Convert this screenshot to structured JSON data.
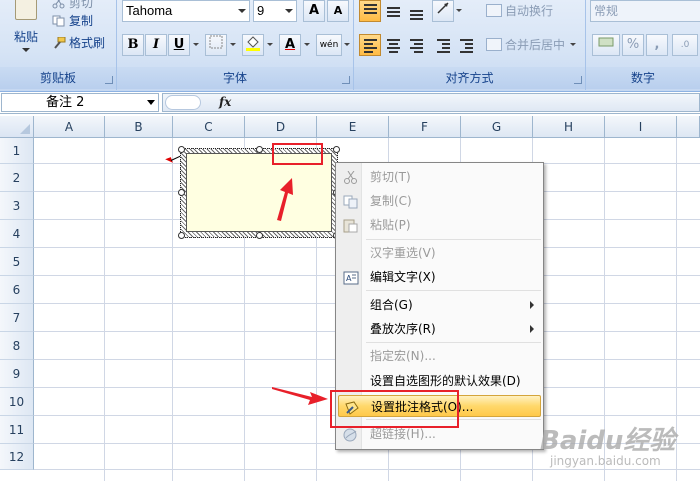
{
  "colors": {
    "accent_red": "#e8202a",
    "comment_fill": "#ffffe1",
    "menu_hover": "#ffd86b"
  },
  "ribbon": {
    "clipboard": {
      "label": "剪贴板",
      "paste": "粘贴",
      "cut": "剪切",
      "copy": "复制",
      "format_painter": "格式刷"
    },
    "font": {
      "label": "字体",
      "font_name": "Tahoma",
      "font_size": "9",
      "bold": "B",
      "italic": "I",
      "underline": "U",
      "grow": "A",
      "shrink": "A",
      "font_color": "A",
      "phonetic": "wén"
    },
    "alignment": {
      "label": "对齐方式",
      "wrap_text": "自动换行",
      "merge_center": "合并后居中"
    },
    "number": {
      "label": "数字",
      "format": "常规",
      "percent": "%",
      "comma": ","
    }
  },
  "formula_bar": {
    "name_box": "备注 2",
    "fx": "fx"
  },
  "grid": {
    "columns": [
      "A",
      "B",
      "C",
      "D",
      "E",
      "F",
      "G",
      "H",
      "I"
    ],
    "rows": [
      "1",
      "2",
      "3",
      "4",
      "5",
      "6",
      "7",
      "8",
      "9",
      "10",
      "11",
      "12"
    ]
  },
  "context_menu": {
    "items": [
      {
        "label": "剪切(T)",
        "icon": "scissors-icon",
        "disabled": true
      },
      {
        "label": "复制(C)",
        "icon": "copy-icon",
        "disabled": true
      },
      {
        "label": "粘贴(P)",
        "icon": "paste-icon",
        "disabled": true
      },
      {
        "label": "汉字重选(V)",
        "icon": "",
        "disabled": true
      },
      {
        "label": "编辑文字(X)",
        "icon": "edit-text-icon",
        "disabled": false
      },
      {
        "label": "组合(G)",
        "icon": "",
        "disabled": false,
        "submenu": true
      },
      {
        "label": "叠放次序(R)",
        "icon": "",
        "disabled": false,
        "submenu": true
      },
      {
        "label": "指定宏(N)...",
        "icon": "",
        "disabled": true
      },
      {
        "label": "设置自选图形的默认效果(D)",
        "icon": "",
        "disabled": false
      },
      {
        "label": "设置批注格式(O)...",
        "icon": "format-comment-icon",
        "disabled": false,
        "highlighted": true
      },
      {
        "label": "超链接(H)...",
        "icon": "hyperlink-icon",
        "disabled": true
      }
    ]
  },
  "watermark": {
    "main": "Baidu经验",
    "sub": "jingyan.baidu.com"
  }
}
